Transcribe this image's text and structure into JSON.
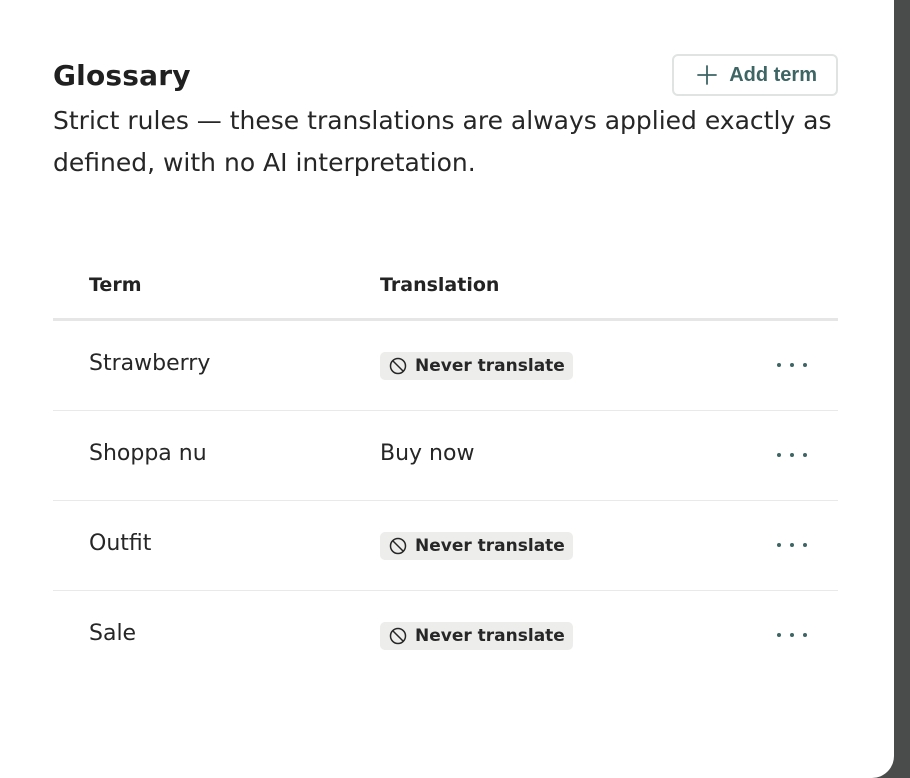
{
  "glossary": {
    "title": "Glossary",
    "add_button_label": "Add term",
    "description": "Strict rules — these translations are always applied exactly as defined, with no AI interpretation."
  },
  "table": {
    "headers": {
      "term": "Term",
      "translation": "Translation"
    },
    "rows": [
      {
        "term": "Strawberry",
        "translation": "Never translate",
        "never_translate": true
      },
      {
        "term": "Shoppa nu",
        "translation": "Buy now",
        "never_translate": false
      },
      {
        "term": "Outfit",
        "translation": "Never translate",
        "never_translate": true
      },
      {
        "term": "Sale",
        "translation": "Never translate",
        "never_translate": true
      }
    ]
  },
  "icons": {
    "add": "plus-icon",
    "never_translate": "no-symbol-icon",
    "row_actions": "more-horizontal-icon"
  },
  "colors": {
    "accent": "#3d6564",
    "badge_bg": "#ededec",
    "backdrop": "#4a4c4b"
  }
}
